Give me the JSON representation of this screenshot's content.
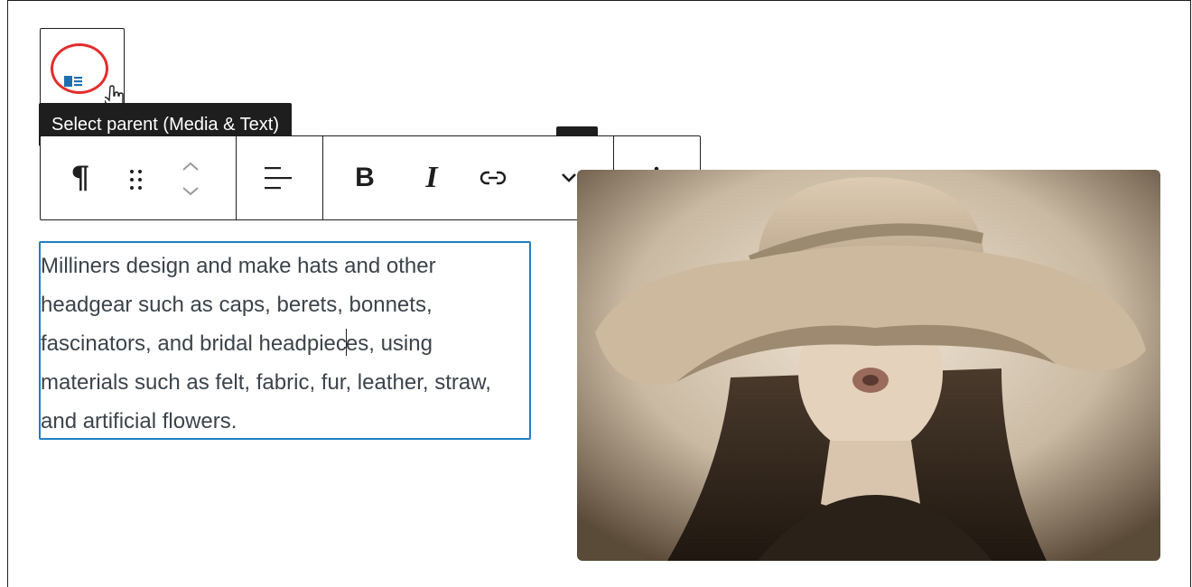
{
  "parent_selector": {
    "icon": "media-and-text-icon",
    "tooltip": "Select parent (Media & Text)"
  },
  "toolbar": {
    "block_type_icon": "paragraph-icon",
    "drag_icon": "drag-handle-icon",
    "move_up_icon": "chevron-up-icon",
    "move_down_icon": "chevron-down-icon",
    "align_icon": "align-left-icon",
    "bold_label": "B",
    "italic_label": "I",
    "link_icon": "link-icon",
    "more_formatting_icon": "chevron-down-icon",
    "options_icon": "more-vertical-icon"
  },
  "paragraph": {
    "before_caret": "Milliners design and make hats and other headgear such as caps, berets, bonnets, fascinators, and bridal headpiec",
    "after_caret": "es, using materials such as felt, fabric, fur, leather, straw, and artificial flowers."
  },
  "media": {
    "kind": "photo of woman in wide-brim hat"
  },
  "colors": {
    "accent": "#1f7fc4",
    "highlight_ring": "#e32d2d",
    "icon_blue": "#1f6fb0",
    "dark": "#1e1e1e"
  }
}
